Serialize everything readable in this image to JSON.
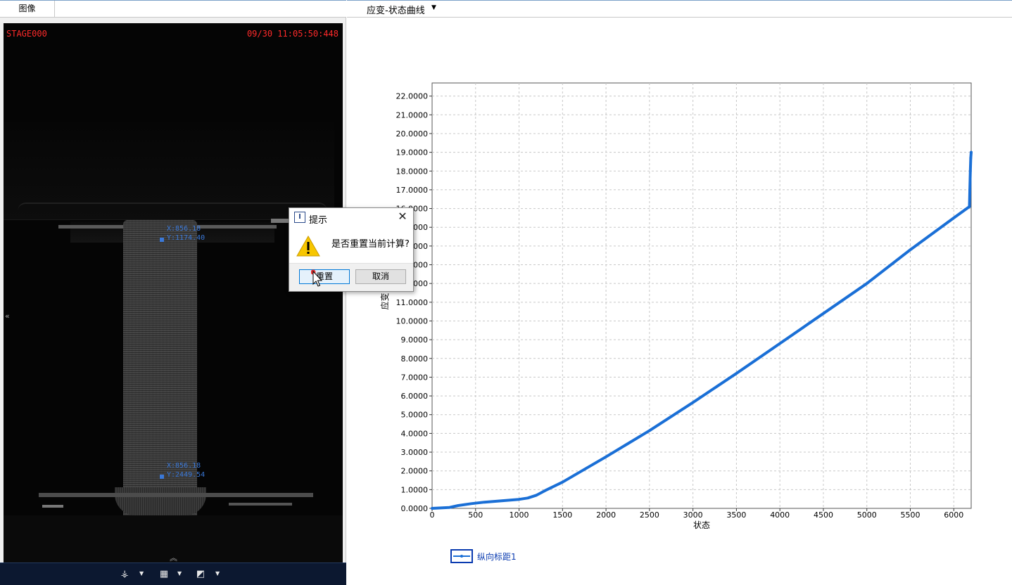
{
  "left_panel": {
    "tab_label": "图像",
    "stage_label": "STAGE000",
    "timestamp": "09/30 11:05:50:448",
    "markers": [
      {
        "x_label": "X:856.18",
        "y_label": "Y:1174.40"
      },
      {
        "x_label": "X:856.18",
        "y_label": "Y:2449.54"
      }
    ],
    "toolbar_icons": [
      "coordinate-axes-icon",
      "grid-select-icon",
      "image-export-icon"
    ]
  },
  "right_panel": {
    "chart_selector_label": "应变-状态曲线"
  },
  "dialog": {
    "title": "提示",
    "message": "是否重置当前计算?",
    "ok_label": "重置",
    "cancel_label": "取消"
  },
  "legend": {
    "series_label": "纵向标距1"
  },
  "colors": {
    "series": "#1a6fd6",
    "overlay_text_red": "#ff2a2a",
    "marker_blue": "#3a78d8",
    "toolbar_bg": "#0c1830"
  },
  "chart_data": {
    "type": "line",
    "xlabel": "状态",
    "ylabel": "应变",
    "xlim": [
      0,
      6200
    ],
    "ylim": [
      0,
      22.7
    ],
    "x_ticks": [
      0,
      500,
      1000,
      1500,
      2000,
      2500,
      3000,
      3500,
      4000,
      4500,
      5000,
      5500,
      6000
    ],
    "y_ticks": [
      0,
      1,
      2,
      3,
      4,
      5,
      6,
      7,
      8,
      9,
      10,
      11,
      12,
      13,
      14,
      15,
      16,
      17,
      18,
      19,
      20,
      21,
      22
    ],
    "y_tick_labels": [
      "0.0000",
      "1.0000",
      "2.0000",
      "3.0000",
      "4.0000",
      "5.0000",
      "6.0000",
      "7.0000",
      "8.0000",
      "9.0000",
      "10.0000",
      "11.0000",
      "12.0000",
      "13.0000",
      "14.0000",
      "15.0000",
      "16.0000",
      "17.0000",
      "18.0000",
      "19.0000",
      "20.0000",
      "21.0000",
      "22.0000"
    ],
    "grid": true,
    "series": [
      {
        "name": "纵向标距1",
        "x": [
          0,
          200,
          300,
          450,
          600,
          800,
          1000,
          1100,
          1200,
          1300,
          1500,
          2000,
          2500,
          3000,
          3500,
          4000,
          4500,
          5000,
          5500,
          6000,
          6180,
          6185,
          6190,
          6195,
          6200
        ],
        "y": [
          0,
          0.05,
          0.15,
          0.25,
          0.33,
          0.4,
          0.48,
          0.55,
          0.7,
          0.95,
          1.4,
          2.75,
          4.15,
          5.65,
          7.2,
          8.8,
          10.4,
          12.0,
          13.8,
          15.5,
          16.1,
          17.0,
          18.0,
          18.7,
          19.0
        ]
      }
    ]
  }
}
